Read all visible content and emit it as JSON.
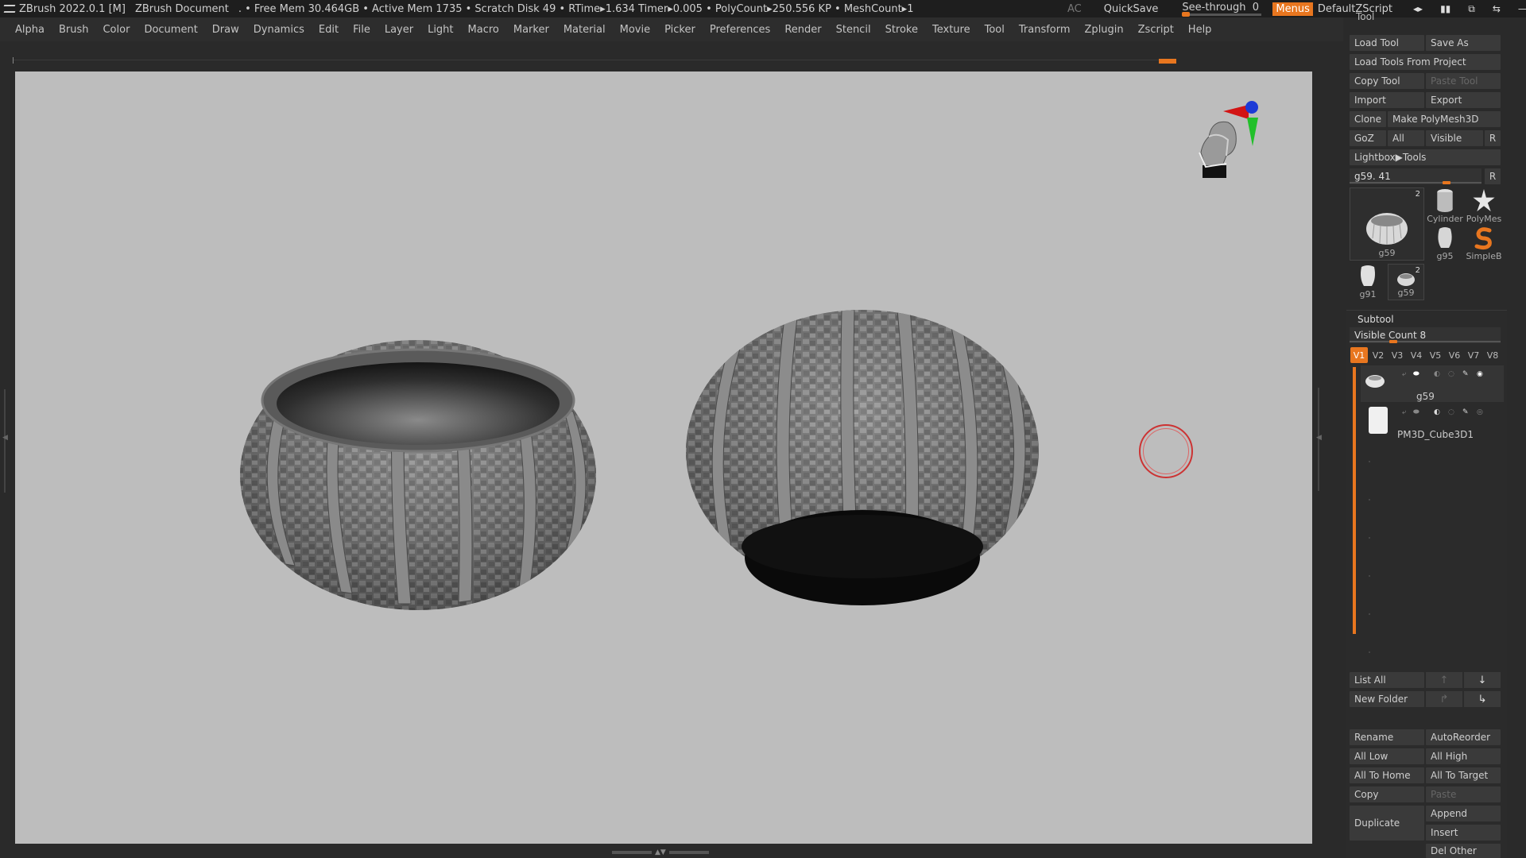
{
  "titlebar": {
    "app": "ZBrush 2022.0.1 [M]",
    "document": "ZBrush Document",
    "stats": ". • Free Mem 30.464GB • Active Mem 1735 • Scratch Disk 49 •  RTime▸1.634 Timer▸0.005 • PolyCount▸250.556 KP • MeshCount▸1",
    "ac": "AC",
    "quicksave": "QuickSave",
    "seethrough_label": "See-through",
    "seethrough_value": "0",
    "menus": "Menus",
    "default_zscript": "DefaultZScript",
    "window_controls": [
      "◂▸",
      "▮▮",
      "⧉",
      "⇆",
      "—",
      "❐",
      "✕"
    ]
  },
  "menu": [
    "Alpha",
    "Brush",
    "Color",
    "Document",
    "Draw",
    "Dynamics",
    "Edit",
    "File",
    "Layer",
    "Light",
    "Macro",
    "Marker",
    "Material",
    "Movie",
    "Picker",
    "Preferences",
    "Render",
    "Stencil",
    "Stroke",
    "Texture",
    "Tool",
    "Transform",
    "Zplugin",
    "Zscript",
    "Help"
  ],
  "tool_palette": {
    "title": "Tool",
    "load_tool": "Load Tool",
    "save_as": "Save As",
    "load_from_project": "Load Tools From Project",
    "copy_tool": "Copy Tool",
    "paste_tool": "Paste Tool",
    "import": "Import",
    "export": "Export",
    "clone": "Clone",
    "make_polymesh": "Make PolyMesh3D",
    "goz": "GoZ",
    "all": "All",
    "visible": "Visible",
    "r": "R",
    "lightbox": "Lightbox▶Tools",
    "current_tool": "g59. 41",
    "current_tool_slider": 0.75,
    "thumbs": [
      {
        "name": "g59",
        "count": "2"
      },
      {
        "name": "Cylinder"
      },
      {
        "name": "PolyMes"
      },
      {
        "name": "g95"
      },
      {
        "name": "SimpleB"
      },
      {
        "name": "g91"
      },
      {
        "name": "g59",
        "count": "2"
      }
    ]
  },
  "subtool": {
    "title": "Subtool",
    "visible_count": "Visible Count 8",
    "versions": [
      "V1",
      "V2",
      "V3",
      "V4",
      "V5",
      "V6",
      "V7",
      "V8"
    ],
    "active_version": "V1",
    "items": [
      {
        "name": "g59"
      },
      {
        "name": "PM3D_Cube3D1"
      }
    ],
    "list_all": "List All",
    "new_folder": "New Folder",
    "rename": "Rename",
    "autoreorder": "AutoReorder",
    "all_low": "All Low",
    "all_high": "All High",
    "all_to_home": "All To Home",
    "all_to_target": "All To Target",
    "copy": "Copy",
    "paste": "Paste",
    "duplicate": "Duplicate",
    "append": "Append",
    "insert": "Insert",
    "del_other": "Del Other"
  },
  "colors": {
    "accent": "#e8761f",
    "canvas": "#bdbdbd",
    "panel": "#2b2b2b",
    "button": "#3a3a3a"
  }
}
